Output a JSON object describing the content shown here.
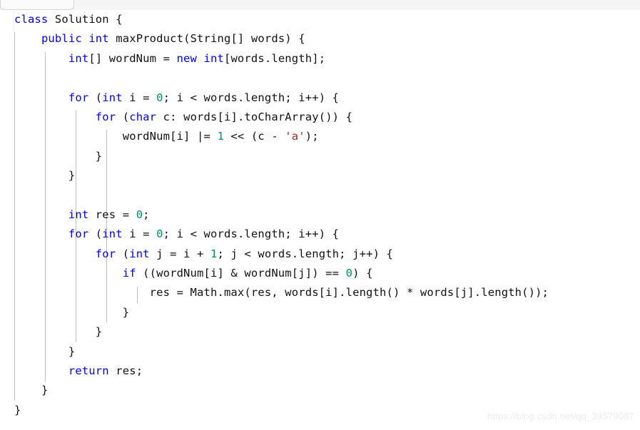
{
  "window": {
    "background": "#ffffff",
    "language": "java"
  },
  "tabstrip": {
    "background": "#f5f5f5",
    "tab_label": ""
  },
  "editor": {
    "font_size_px": 15.5,
    "line_height_px": 27.4,
    "indent_guide_color": "#bfbfbf",
    "indent_guide_x": [
      20,
      63,
      106,
      149,
      192
    ],
    "colors": {
      "keyword": "#0000e6",
      "number": "#008f6b",
      "string": "#9c2a2a",
      "plain": "#111111",
      "watermark": "#ececec"
    },
    "lines": [
      {
        "n": 1,
        "indent": 0,
        "tokens": [
          {
            "t": "kw",
            "v": "class"
          },
          {
            "t": "pln",
            "v": " Solution {"
          }
        ]
      },
      {
        "n": 2,
        "indent": 1,
        "tokens": [
          {
            "t": "kw",
            "v": "public"
          },
          {
            "t": "pln",
            "v": " "
          },
          {
            "t": "kw",
            "v": "int"
          },
          {
            "t": "pln",
            "v": " maxProduct(String[] words) {"
          }
        ]
      },
      {
        "n": 3,
        "indent": 2,
        "tokens": [
          {
            "t": "kw",
            "v": "int"
          },
          {
            "t": "pln",
            "v": "[] wordNum = "
          },
          {
            "t": "kw",
            "v": "new"
          },
          {
            "t": "pln",
            "v": " "
          },
          {
            "t": "kw",
            "v": "int"
          },
          {
            "t": "pln",
            "v": "[words.length];"
          }
        ]
      },
      {
        "n": 4,
        "indent": 0,
        "tokens": []
      },
      {
        "n": 5,
        "indent": 2,
        "tokens": [
          {
            "t": "kw",
            "v": "for"
          },
          {
            "t": "pln",
            "v": " ("
          },
          {
            "t": "kw",
            "v": "int"
          },
          {
            "t": "pln",
            "v": " i = "
          },
          {
            "t": "num",
            "v": "0"
          },
          {
            "t": "pln",
            "v": "; i < words.length; i++) {"
          }
        ]
      },
      {
        "n": 6,
        "indent": 3,
        "tokens": [
          {
            "t": "kw",
            "v": "for"
          },
          {
            "t": "pln",
            "v": " ("
          },
          {
            "t": "kw",
            "v": "char"
          },
          {
            "t": "pln",
            "v": " c: words[i].toCharArray()) {"
          }
        ]
      },
      {
        "n": 7,
        "indent": 4,
        "tokens": [
          {
            "t": "pln",
            "v": "wordNum[i] |= "
          },
          {
            "t": "num",
            "v": "1"
          },
          {
            "t": "pln",
            "v": " << (c - "
          },
          {
            "t": "str",
            "v": "'a'"
          },
          {
            "t": "pln",
            "v": ");"
          }
        ]
      },
      {
        "n": 8,
        "indent": 3,
        "tokens": [
          {
            "t": "pln",
            "v": "}"
          }
        ]
      },
      {
        "n": 9,
        "indent": 2,
        "tokens": [
          {
            "t": "pln",
            "v": "}"
          }
        ]
      },
      {
        "n": 10,
        "indent": 0,
        "tokens": []
      },
      {
        "n": 11,
        "indent": 2,
        "tokens": [
          {
            "t": "kw",
            "v": "int"
          },
          {
            "t": "pln",
            "v": " res = "
          },
          {
            "t": "num",
            "v": "0"
          },
          {
            "t": "pln",
            "v": ";"
          }
        ]
      },
      {
        "n": 12,
        "indent": 2,
        "tokens": [
          {
            "t": "kw",
            "v": "for"
          },
          {
            "t": "pln",
            "v": " ("
          },
          {
            "t": "kw",
            "v": "int"
          },
          {
            "t": "pln",
            "v": " i = "
          },
          {
            "t": "num",
            "v": "0"
          },
          {
            "t": "pln",
            "v": "; i < words.length; i++) {"
          }
        ]
      },
      {
        "n": 13,
        "indent": 3,
        "tokens": [
          {
            "t": "kw",
            "v": "for"
          },
          {
            "t": "pln",
            "v": " ("
          },
          {
            "t": "kw",
            "v": "int"
          },
          {
            "t": "pln",
            "v": " j = i + "
          },
          {
            "t": "num",
            "v": "1"
          },
          {
            "t": "pln",
            "v": "; j < words.length; j++) {"
          }
        ]
      },
      {
        "n": 14,
        "indent": 4,
        "tokens": [
          {
            "t": "kw",
            "v": "if"
          },
          {
            "t": "pln",
            "v": " ((wordNum[i] & wordNum[j]) == "
          },
          {
            "t": "num",
            "v": "0"
          },
          {
            "t": "pln",
            "v": ") {"
          }
        ]
      },
      {
        "n": 15,
        "indent": 5,
        "tokens": [
          {
            "t": "pln",
            "v": "res = Math.max(res, words[i].length() * words[j].length());"
          }
        ]
      },
      {
        "n": 16,
        "indent": 4,
        "tokens": [
          {
            "t": "pln",
            "v": "}"
          }
        ]
      },
      {
        "n": 17,
        "indent": 3,
        "tokens": [
          {
            "t": "pln",
            "v": "}"
          }
        ]
      },
      {
        "n": 18,
        "indent": 2,
        "tokens": [
          {
            "t": "pln",
            "v": "}"
          }
        ]
      },
      {
        "n": 19,
        "indent": 2,
        "tokens": [
          {
            "t": "kw",
            "v": "return"
          },
          {
            "t": "pln",
            "v": " res;"
          }
        ]
      },
      {
        "n": 20,
        "indent": 1,
        "tokens": [
          {
            "t": "pln",
            "v": "}"
          }
        ]
      },
      {
        "n": 21,
        "indent": 0,
        "tokens": [
          {
            "t": "pln",
            "v": "}"
          }
        ]
      }
    ]
  },
  "watermark": {
    "text": "https://blog.csdn.net/qq_39579087"
  }
}
